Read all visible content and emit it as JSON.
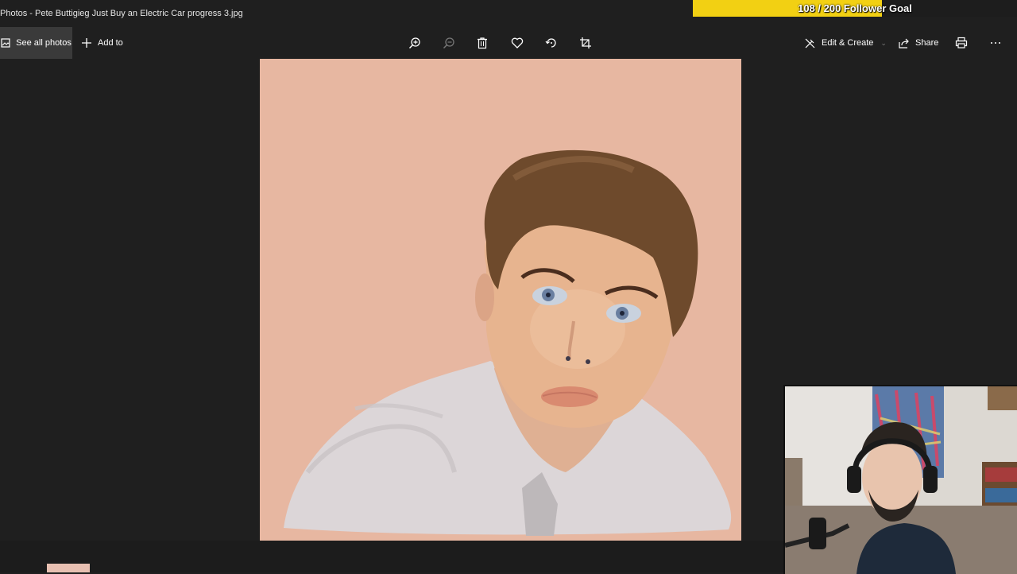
{
  "window": {
    "title": "Photos - Pete Buttigieg Just Buy an Electric Car progress 3.jpg"
  },
  "overlay": {
    "follower_goal_label": "108 / 200 Follower Goal",
    "follower_current": 108,
    "follower_target": 200,
    "accent": "#f2d013"
  },
  "toolbar": {
    "see_all_label": "See all photos",
    "add_to_label": "Add to",
    "edit_create_label": "Edit & Create",
    "share_label": "Share",
    "icons": [
      "zoom-in-icon",
      "zoom-out-icon",
      "delete-icon",
      "favorite-icon",
      "rotate-icon",
      "crop-icon",
      "print-icon",
      "more-icon"
    ]
  },
  "colors": {
    "background": "#1f1f1f",
    "canvas": "#e7b7a1"
  }
}
